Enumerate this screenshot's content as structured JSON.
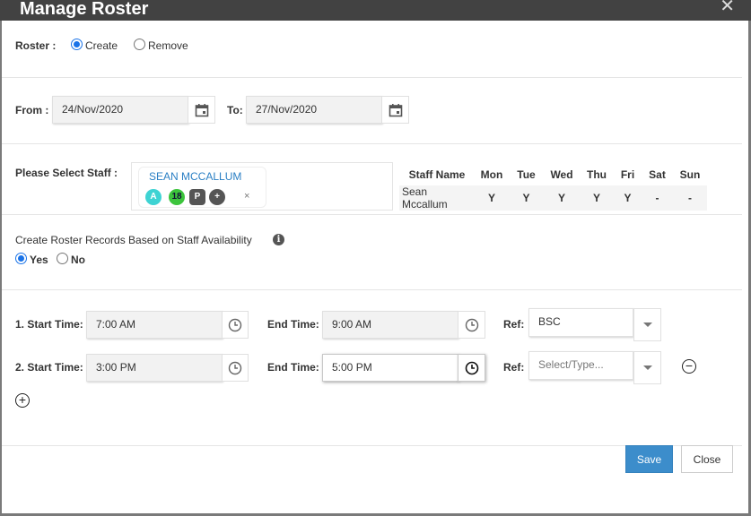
{
  "dialog": {
    "title": "Manage Roster",
    "close_glyph": "✕"
  },
  "roster": {
    "label": "Roster :",
    "options": [
      {
        "label": "Create",
        "checked": true
      },
      {
        "label": "Remove",
        "checked": false
      }
    ]
  },
  "dates": {
    "from_label": "From :",
    "from_value": "24/Nov/2020",
    "to_label": "To:",
    "to_value": "27/Nov/2020"
  },
  "staff": {
    "label": "Please Select Staff :",
    "selected": {
      "name": "SEAN MCCALLUM",
      "badges": [
        "A",
        "18",
        "P",
        "+"
      ],
      "remove_glyph": "×"
    },
    "table": {
      "headers": [
        "Staff Name",
        "Mon",
        "Tue",
        "Wed",
        "Thu",
        "Fri",
        "Sat",
        "Sun"
      ],
      "rows": [
        [
          "Sean Mccallum",
          "Y",
          "Y",
          "Y",
          "Y",
          "Y",
          "-",
          "-"
        ]
      ]
    }
  },
  "availability": {
    "label": "Create Roster Records Based on Staff Availability",
    "info_glyph": "i",
    "options": [
      {
        "label": "Yes",
        "checked": true
      },
      {
        "label": "No",
        "checked": false
      }
    ]
  },
  "shifts": [
    {
      "start_label": "1. Start Time:",
      "start_value": "7:00 AM",
      "end_label": "End Time:",
      "end_value": "9:00 AM",
      "ref_label": "Ref:",
      "ref_value": "BSC",
      "ref_placeholder": ""
    },
    {
      "start_label": "2. Start Time:",
      "start_value": "3:00 PM",
      "end_label": "End Time:",
      "end_value": "5:00 PM",
      "ref_label": "Ref:",
      "ref_value": "",
      "ref_placeholder": "Select/Type..."
    }
  ],
  "icons": {
    "remove_shift": "−",
    "add_shift": "+"
  },
  "buttons": {
    "save": "Save",
    "close": "Close"
  },
  "colors": {
    "primary": "#3c8dcb",
    "titlebar": "#424242",
    "link": "#2a7fc4"
  }
}
